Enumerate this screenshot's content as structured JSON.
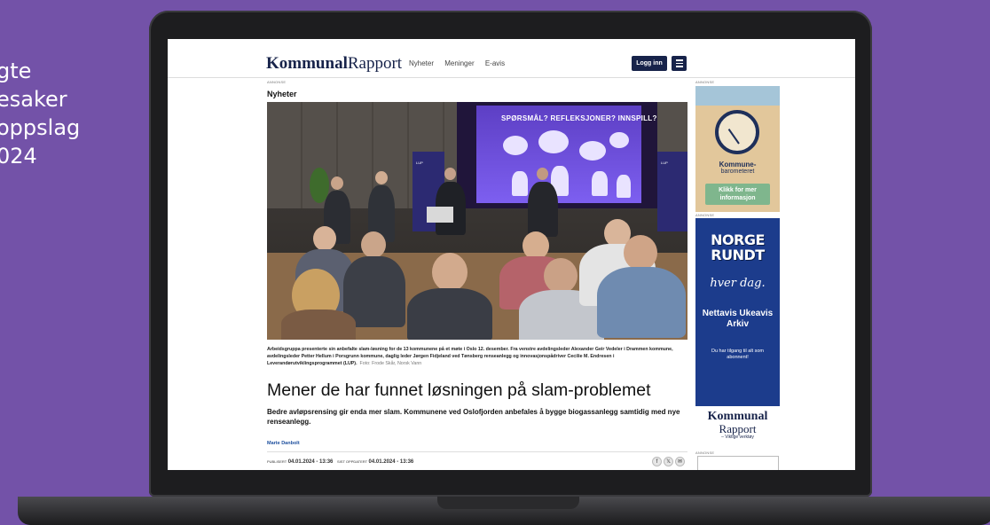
{
  "promo": {
    "lines": [
      "gte",
      "esaker",
      "oppslag",
      "024"
    ]
  },
  "header": {
    "logo_bold": "Kommunal",
    "logo_light": "Rapport",
    "nav": [
      "Nyheter",
      "Meninger",
      "E-avis"
    ],
    "login_label": "Logg inn"
  },
  "ad_label": "ANNONSE",
  "article": {
    "section": "Nyheter",
    "slide_text": "SPØRSMÅL? REFLEKSJONER? INNSPILL?",
    "banner_text": "LUP",
    "caption": "Arbeidsgruppa presenterte sin anbefalte slam-løsning for de 13 kommunene på et møte i Oslo 12. desember. Fra venstre avdelingsleder Alexander Geir Vedeler i Drammen kommune, avdelingsleder Petter Hellum i Porsgrunn kommune, daglig leder Jørgen Fidjeland ved Tønsberg renseanlegg og innovasjonspådriver Cecilie M. Endresen i Leverandørutviklingsprogrammet (LUP).",
    "credit": "Foto: Frode Skår, Norsk Vann",
    "headline": "Mener de har funnet løsningen på slam-problemet",
    "lead": "Bedre avløpsrensing gir enda mer slam. Kommunene ved Oslofjorden anbefales å bygge biogassanlegg samtidig med nye renseanlegg.",
    "author": "Marte Danbolt",
    "published_label": "PUBLISERT",
    "published": "04.01.2024 - 13:36",
    "updated_label": "SIST OPPDATERT",
    "updated": "04.01.2024 - 13:36"
  },
  "ads": {
    "barometer_brand": "Kommune-",
    "barometer_sub": "barometeret",
    "barometer_cta": "Klikk for mer informasjon",
    "norge_title": "NORGE RUNDT",
    "norge_script": "hver dag.",
    "norge_main": "Nettavis Ukeavis Arkiv",
    "norge_small": "Du har tilgang til alt som abonnent!",
    "brand_bold": "Kommunal",
    "brand_light": "Rapport",
    "brand_tagline": "– Viktige verktøy"
  }
}
